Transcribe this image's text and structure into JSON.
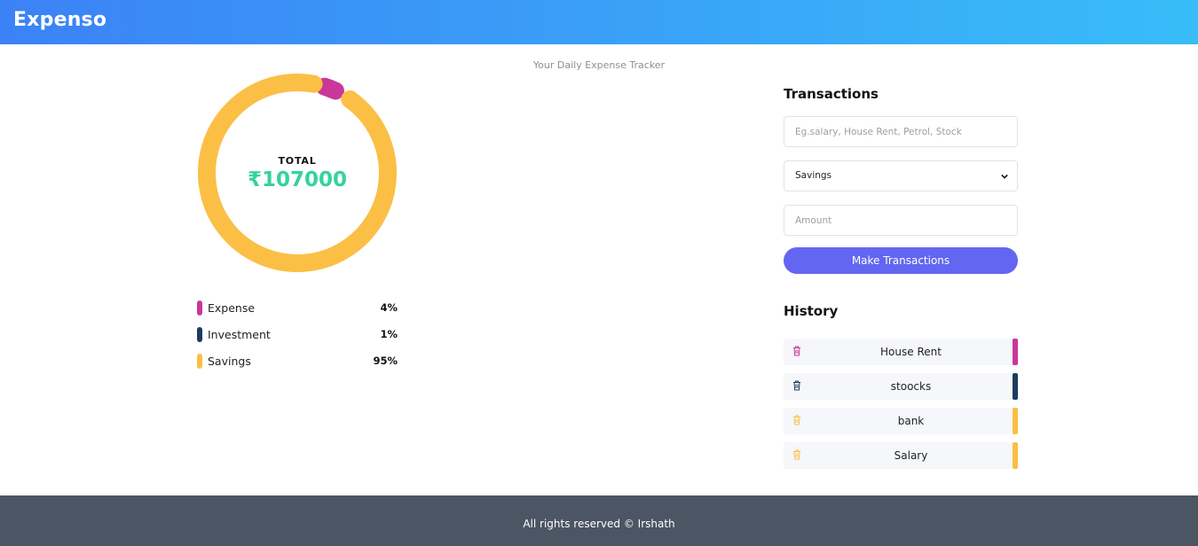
{
  "header": {
    "brand": "Expenso"
  },
  "tagline": "Your Daily Expense Tracker",
  "summary": {
    "total_label": "TOTAL",
    "total_value": "₹107000"
  },
  "chart_data": {
    "type": "pie",
    "categories": [
      "Expense",
      "Investment",
      "Savings"
    ],
    "values": [
      4,
      1,
      95
    ],
    "colors": [
      "#c9379a",
      "#1e3a5f",
      "#fbbf45"
    ],
    "center_label": "TOTAL",
    "center_value": "₹107000"
  },
  "legend": [
    {
      "name": "Expense",
      "pct": "4%",
      "color": "#c9379a"
    },
    {
      "name": "Investment",
      "pct": "1%",
      "color": "#1e3a5f"
    },
    {
      "name": "Savings",
      "pct": "95%",
      "color": "#fbbf45"
    }
  ],
  "transactions": {
    "title": "Transactions",
    "name_placeholder": "Eg.salary, House Rent, Petrol, Stock",
    "category_selected": "Savings",
    "amount_placeholder": "Amount",
    "submit_label": "Make Transactions"
  },
  "history": {
    "title": "History",
    "items": [
      {
        "label": "House Rent",
        "color": "#c9379a",
        "icon": "trash-icon"
      },
      {
        "label": "stoocks",
        "color": "#1e3a5f",
        "icon": "trash-icon"
      },
      {
        "label": "bank",
        "color": "#fbbf45",
        "icon": "trash-icon"
      },
      {
        "label": "Salary",
        "color": "#fbbf45",
        "icon": "trash-icon"
      }
    ]
  },
  "footer": {
    "text": "All rights reserved © Irshath"
  }
}
